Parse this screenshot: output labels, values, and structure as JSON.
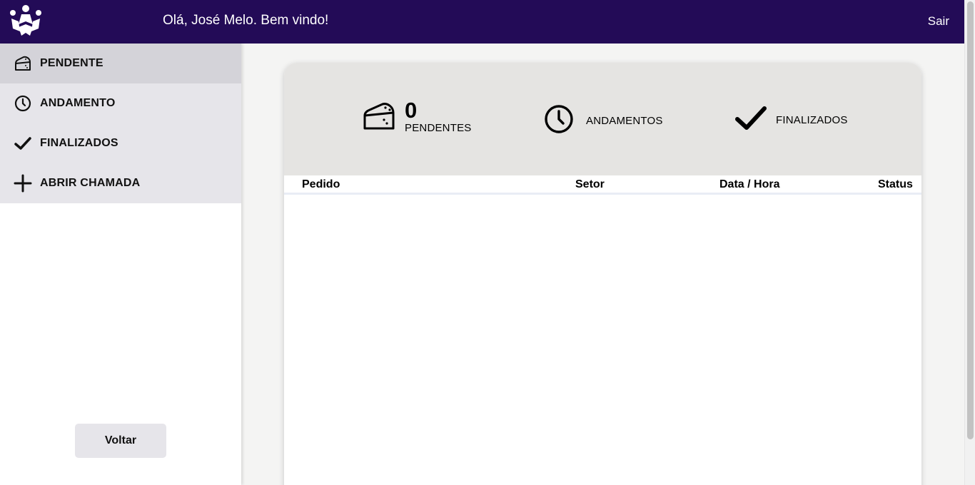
{
  "header": {
    "greeting": "Olá, José Melo. Bem vindo!",
    "logout_label": "Sair",
    "background_color": "#230b57"
  },
  "sidebar": {
    "items": [
      {
        "label": "PENDENTE",
        "icon": "cheese-icon",
        "active": true
      },
      {
        "label": "ANDAMENTO",
        "icon": "clock-icon",
        "active": false
      },
      {
        "label": "FINALIZADOS",
        "icon": "check-icon",
        "active": false
      },
      {
        "label": "ABRIR CHAMADA",
        "icon": "plus-icon",
        "active": false
      }
    ],
    "back_label": "Voltar"
  },
  "summary": {
    "pending_count": "0",
    "pending_label": "PENDENTES",
    "in_progress_label": "ANDAMENTOS",
    "finished_label": "FINALIZADOS"
  },
  "table": {
    "columns": [
      "Pedido",
      "Setor",
      "Data / Hora",
      "Status"
    ],
    "rows": []
  }
}
